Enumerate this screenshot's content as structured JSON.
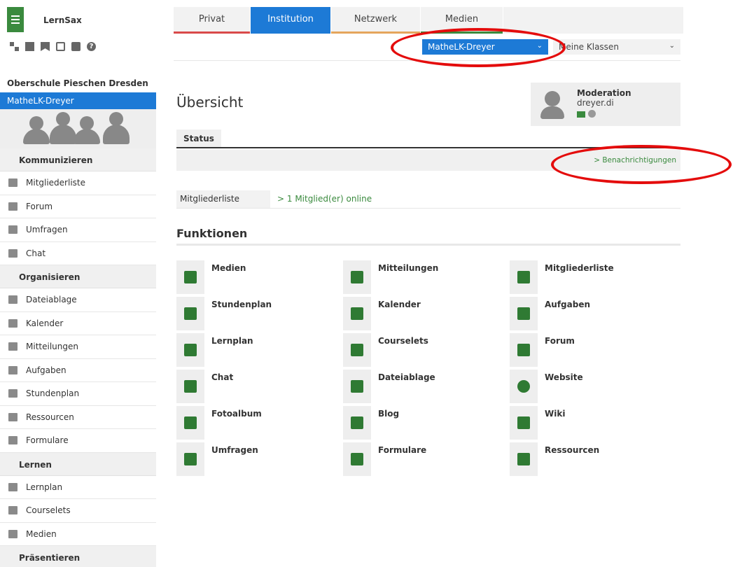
{
  "app": {
    "brand": "LernSax"
  },
  "tabs": [
    {
      "label": "Privat"
    },
    {
      "label": "Institution"
    },
    {
      "label": "Netzwerk"
    },
    {
      "label": "Medien"
    }
  ],
  "toolbar": {
    "group_select": "MatheLK-Dreyer",
    "class_select": "Meine Klassen"
  },
  "sidebar": {
    "school": "Oberschule Pieschen Dresden",
    "group": "MatheLK-Dreyer",
    "sections": [
      {
        "title": "Kommunizieren",
        "items": [
          "Mitgliederliste",
          "Forum",
          "Umfragen",
          "Chat"
        ]
      },
      {
        "title": "Organisieren",
        "items": [
          "Dateiablage",
          "Kalender",
          "Mitteilungen",
          "Aufgaben",
          "Stundenplan",
          "Ressourcen",
          "Formulare"
        ]
      },
      {
        "title": "Lernen",
        "items": [
          "Lernplan",
          "Courselets",
          "Medien"
        ]
      },
      {
        "title": "Präsentieren",
        "items": []
      }
    ]
  },
  "main": {
    "title": "Übersicht",
    "moderation": {
      "title": "Moderation",
      "user": "dreyer.di"
    },
    "status_tab": "Status",
    "notifications_link": "> Benachrichtigungen",
    "members": {
      "label": "Mitgliederliste",
      "link": "> 1 Mitglied(er) online"
    },
    "functions_title": "Funktionen",
    "functions": [
      [
        "Medien",
        "Mitteilungen",
        "Mitgliederliste"
      ],
      [
        "Stundenplan",
        "Kalender",
        "Aufgaben"
      ],
      [
        "Lernplan",
        "Courselets",
        "Forum"
      ],
      [
        "Chat",
        "Dateiablage",
        "Website"
      ],
      [
        "Fotoalbum",
        "Blog",
        "Wiki"
      ],
      [
        "Umfragen",
        "Formulare",
        "Ressourcen"
      ]
    ]
  },
  "colors": {
    "accent_blue": "#1d7ad6",
    "accent_green": "#3a8a3e",
    "highlight_red": "#e40c0c"
  }
}
